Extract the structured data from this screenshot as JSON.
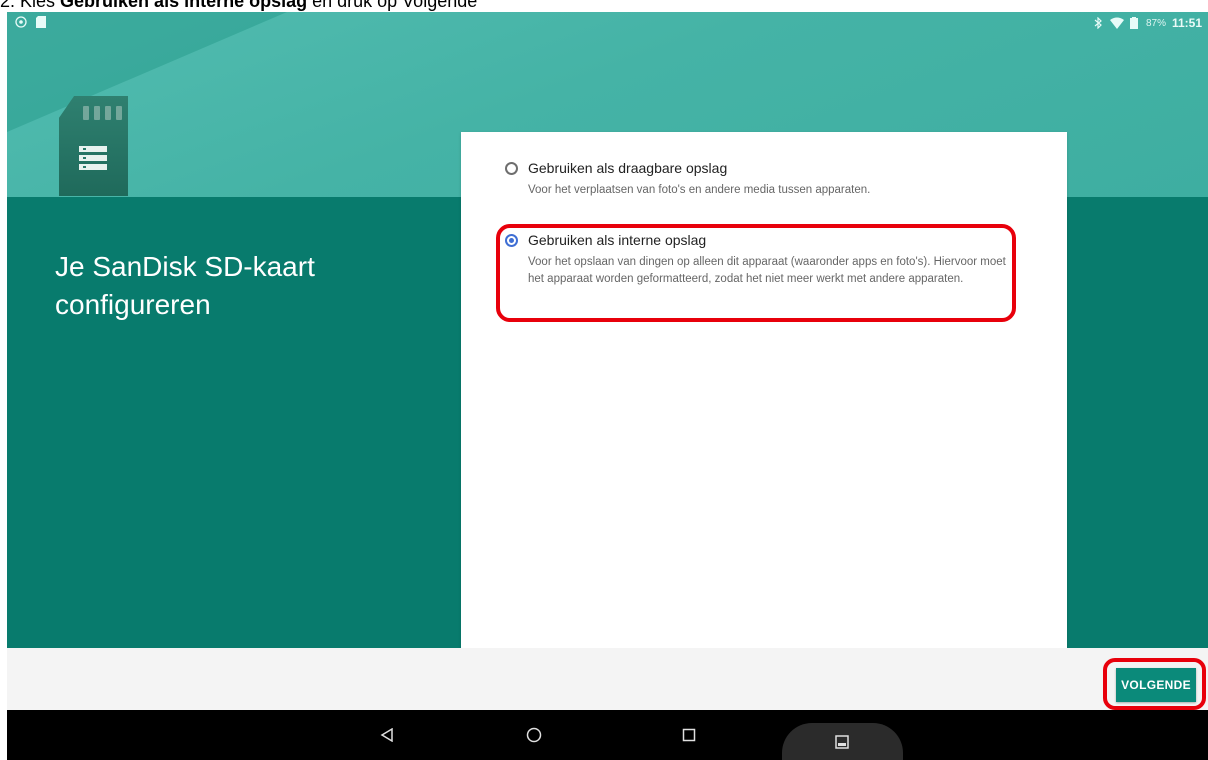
{
  "caption": {
    "prefix": "2. Kies ",
    "bold": "Gebruiken als interne opslag",
    "suffix": " en druk op Volgende"
  },
  "status_bar": {
    "battery": "87%",
    "time": "11:51",
    "left_icons": [
      "android-debug-icon",
      "notification-icon"
    ],
    "right_icons": [
      "bluetooth-icon",
      "wifi-icon",
      "battery-icon"
    ]
  },
  "setup": {
    "title_line1": "Je SanDisk SD-kaart",
    "title_line2": "configureren"
  },
  "options": [
    {
      "label": "Gebruiken als draagbare opslag",
      "description": "Voor het verplaatsen van foto's en andere media tussen apparaten.",
      "selected": false
    },
    {
      "label": "Gebruiken als interne opslag",
      "description": "Voor het opslaan van dingen op alleen dit apparaat (waaronder apps en foto's). Hiervoor moet het apparaat worden geformatteerd, zodat het niet meer werkt met andere apparaten.",
      "selected": true
    }
  ],
  "actions": {
    "next_label": "VOLGENDE"
  },
  "nav_bar": {
    "buttons": [
      "back-icon",
      "home-icon",
      "recents-icon",
      "screenshot-icon"
    ]
  },
  "colors": {
    "teal_top": "#45b3a6",
    "teal_bottom": "#087b6d",
    "button": "#0b8a7a",
    "highlight": "#e8000b",
    "radio_selected": "#3f6fd4"
  }
}
